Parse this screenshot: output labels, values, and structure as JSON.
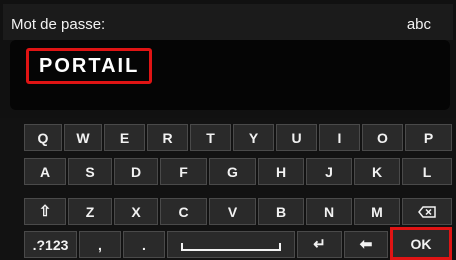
{
  "header": {
    "label": "Mot de passe:",
    "mode": "abc"
  },
  "input": {
    "value": "PORTAIL"
  },
  "keyboard": {
    "row1": [
      "Q",
      "W",
      "E",
      "R",
      "T",
      "Y",
      "U",
      "I",
      "O",
      "P"
    ],
    "row2": [
      "A",
      "S",
      "D",
      "F",
      "G",
      "H",
      "J",
      "K",
      "L"
    ],
    "row3": [
      "Z",
      "X",
      "C",
      "V",
      "B",
      "N",
      "M"
    ],
    "shift_icon": "shift-icon",
    "backspace_icon": "backspace-icon",
    "symbols_label": ".?123",
    "comma_label": ",",
    "period_label": ".",
    "space_icon": "space-bar-icon",
    "enter_icon": "enter-icon",
    "arrow_icon": "back-arrow-icon",
    "ok_label": "OK"
  },
  "colors": {
    "highlight": "#e01414",
    "key_bg": "#2a2a2a",
    "key_border": "#4a4a4a",
    "text": "#f2f2f2",
    "background": "#111111"
  }
}
